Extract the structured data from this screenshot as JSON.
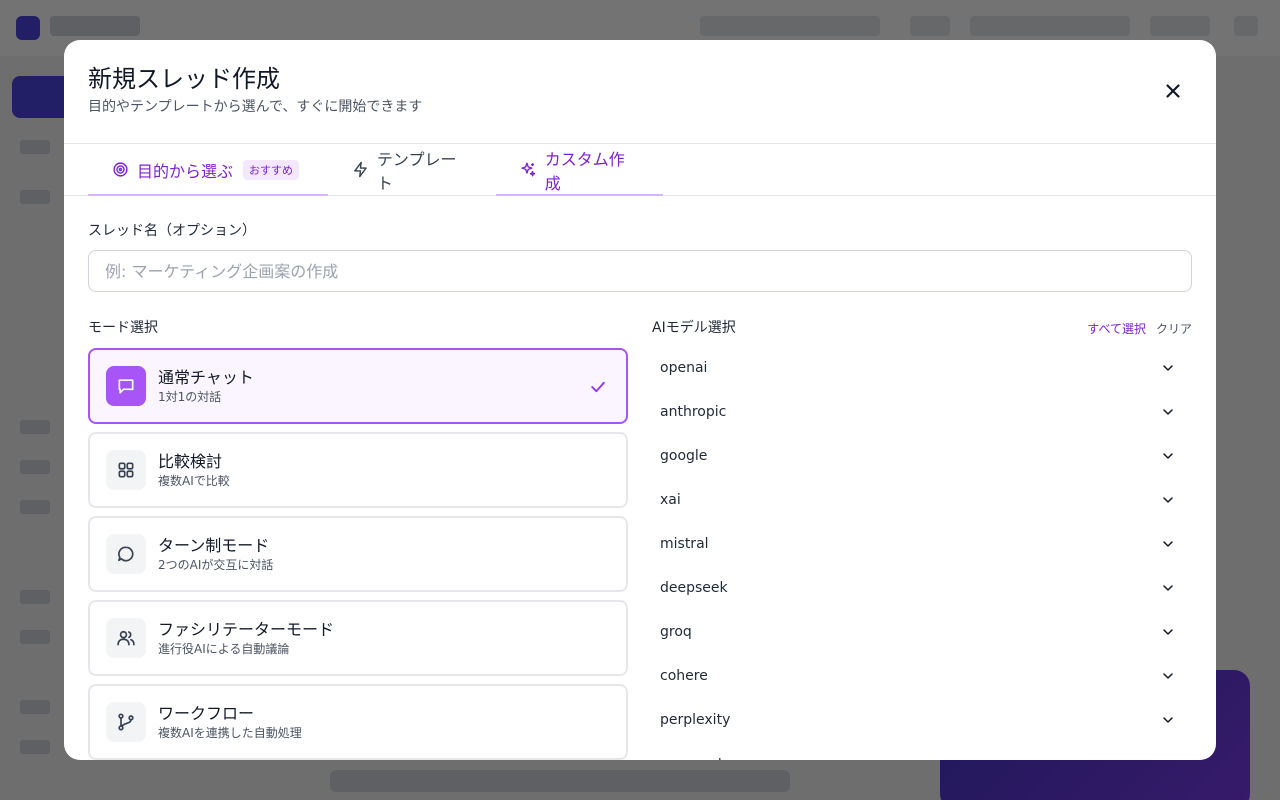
{
  "modal": {
    "title": "新規スレッド作成",
    "subtitle": "目的やテンプレートから選んで、すぐに開始できます"
  },
  "tabs": [
    {
      "label": "目的から選ぶ",
      "badge": "おすすめ",
      "icon": "target-icon"
    },
    {
      "label": "テンプレート",
      "icon": "lightning-icon"
    },
    {
      "label": "カスタム作成",
      "icon": "sparkles-icon"
    }
  ],
  "thread_name": {
    "label": "スレッド名（オプション）",
    "placeholder": "例: マーケティング企画案の作成",
    "value": ""
  },
  "mode_section": {
    "label": "モード選択",
    "selected": "通常チャット",
    "modes": [
      {
        "title": "通常チャット",
        "desc": "1対1の対話",
        "icon": "chat-bubble-icon"
      },
      {
        "title": "比較検討",
        "desc": "複数AIで比較",
        "icon": "grid-icon"
      },
      {
        "title": "ターン制モード",
        "desc": "2つのAIが交互に対話",
        "icon": "message-circle-icon"
      },
      {
        "title": "ファシリテーターモード",
        "desc": "進行役AIによる自動議論",
        "icon": "users-icon"
      },
      {
        "title": "ワークフロー",
        "desc": "複数AIを連携した自動処理",
        "icon": "git-branch-icon"
      }
    ]
  },
  "model_section": {
    "label": "AIモデル選択",
    "select_all": "すべて選択",
    "clear": "クリア",
    "providers": [
      "openai",
      "anthropic",
      "google",
      "xai",
      "mistral",
      "deepseek",
      "groq",
      "cohere",
      "perplexity",
      "openrouter"
    ]
  },
  "colors": {
    "accent": "#a855f7",
    "accent_text": "#7e22ce",
    "selected_bg": "#faf5ff"
  }
}
